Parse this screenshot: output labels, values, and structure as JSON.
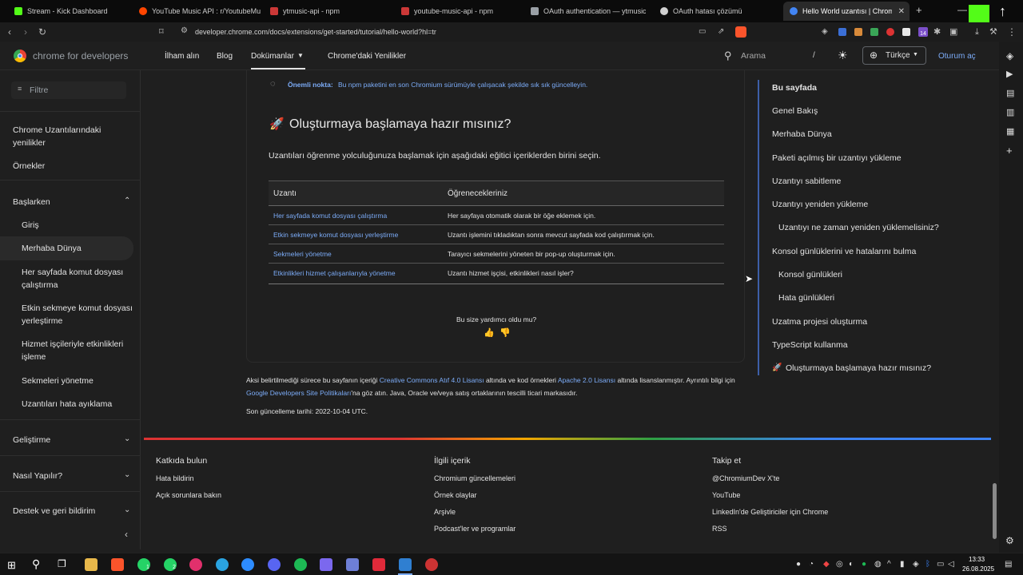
{
  "browser": {
    "tabs": [
      {
        "title": "Stream - Kick Dashboard",
        "color": "#53fc18"
      },
      {
        "title": "YouTube Music API : r/YoutubeMusic",
        "color": "#ff4500"
      },
      {
        "title": "ytmusic-api - npm",
        "color": "#cb3837"
      },
      {
        "title": "youtube-music-api - npm",
        "color": "#cb3837"
      },
      {
        "title": "OAuth authentication — ytmusicapi",
        "color": "#9aa0a6"
      },
      {
        "title": "OAuth hatası çözümü",
        "color": "#d0d0d0"
      },
      {
        "title": "Hello World uzantısı | Chrome",
        "color": "#4285f4"
      }
    ],
    "new_tab": "+",
    "url": "developer.chrome.com/docs/extensions/get-started/tutorial/hello-world?hl=tr",
    "extension_badge": "14"
  },
  "site": {
    "brand": "chrome for developers",
    "nav": [
      "İlham alın",
      "Blog",
      "Dokümanlar",
      "Chrome'daki Yenilikler"
    ],
    "search_placeholder": "Arama",
    "search_shortcut": "/",
    "language": "Türkçe",
    "signin": "Oturum aç"
  },
  "sidebar": {
    "filter_placeholder": "Filtre",
    "items": [
      {
        "label": "Chrome Uzantılarındaki yenilikler"
      },
      {
        "label": "Örnekler"
      },
      {
        "label": "Başlarken"
      },
      {
        "label": "Giriş"
      },
      {
        "label": "Merhaba Dünya"
      },
      {
        "label": "Her sayfada komut dosyası çalıştırma"
      },
      {
        "label": "Etkin sekmeye komut dosyası yerleştirme"
      },
      {
        "label": "Hizmet işçileriyle etkinlikleri işleme"
      },
      {
        "label": "Sekmeleri yönetme"
      },
      {
        "label": "Uzantıları hata ayıklama"
      },
      {
        "label": "Geliştirme"
      },
      {
        "label": "Nasıl Yapılır?"
      },
      {
        "label": "Destek ve geri bildirim"
      }
    ]
  },
  "main": {
    "note_label": "Önemli nokta:",
    "note_text": "Bu npm paketini en son Chromium sürümüyle çalışacak şekilde sık sık güncelleyin.",
    "heading_emoji": "🚀",
    "heading": "Oluşturmaya başlamaya hazır mısınız?",
    "intro": "Uzantıları öğrenme yolculuğunuza başlamak için aşağıdaki eğitici içeriklerden birini seçin.",
    "table": {
      "headers": [
        "Uzantı",
        "Öğrenecekleriniz"
      ],
      "rows": [
        {
          "link": "Her sayfada komut dosyası çalıştırma",
          "desc": "Her sayfaya otomatik olarak bir öğe eklemek için."
        },
        {
          "link": "Etkin sekmeye komut dosyası yerleştirme",
          "desc": "Uzantı işlemini tıkladıktan sonra mevcut sayfada kod çalıştırmak için."
        },
        {
          "link": "Sekmeleri yönetme",
          "desc": "Tarayıcı sekmelerini yöneten bir pop-up oluşturmak için."
        },
        {
          "link": "Etkinlikleri hizmet çalışanlarıyla yönetme",
          "desc": "Uzantı hizmet işçisi, etkinlikleri nasıl işler?"
        }
      ]
    },
    "feedback_q": "Bu size yardımcı oldu mu?",
    "license_1": "Aksi belirtilmediği sürece bu sayfanın içeriği",
    "license_link1": "Creative Commons Atıf 4.0 Lisansı",
    "license_2": "altında ve kod örnekleri",
    "license_link2": "Apache 2.0 Lisansı",
    "license_3": "altında lisanslanmıştır. Ayrıntılı bilgi için",
    "license_link3": "Google Developers Site Politikaları",
    "license_4": "'na göz atın. Java, Oracle ve/veya satış ortaklarının tescilli ticari markasıdır.",
    "last_updated": "Son güncelleme tarihi: 2022-10-04 UTC."
  },
  "toc": {
    "title": "Bu sayfada",
    "items": [
      {
        "label": "Genel Bakış"
      },
      {
        "label": "Merhaba Dünya"
      },
      {
        "label": "Paketi açılmış bir uzantıyı yükleme"
      },
      {
        "label": "Uzantıyı sabitleme"
      },
      {
        "label": "Uzantıyı yeniden yükleme"
      },
      {
        "label": "Uzantıyı ne zaman yeniden yüklemelisiniz?"
      },
      {
        "label": "Konsol günlüklerini ve hatalarını bulma"
      },
      {
        "label": "Konsol günlükleri"
      },
      {
        "label": "Hata günlükleri"
      },
      {
        "label": "Uzatma projesi oluşturma"
      },
      {
        "label": "TypeScript kullanma"
      },
      {
        "label": "Oluşturmaya başlamaya hazır mısınız?"
      }
    ]
  },
  "footer": {
    "col1": {
      "title": "Katkıda bulun",
      "links": [
        "Hata bildirin",
        "Açık sorunlara bakın"
      ]
    },
    "col2": {
      "title": "İlgili içerik",
      "links": [
        "Chromium güncellemeleri",
        "Örnek olaylar",
        "Arşivle",
        "Podcast'ler ve programlar"
      ]
    },
    "col3": {
      "title": "Takip et",
      "links": [
        "@ChromiumDev X'te",
        "YouTube",
        "LinkedIn'de Geliştiriciler için Chrome",
        "RSS"
      ]
    }
  },
  "taskbar": {
    "time": "13:33",
    "date": "26.08.2025",
    "badge_a": "1",
    "badge_b": "2"
  }
}
